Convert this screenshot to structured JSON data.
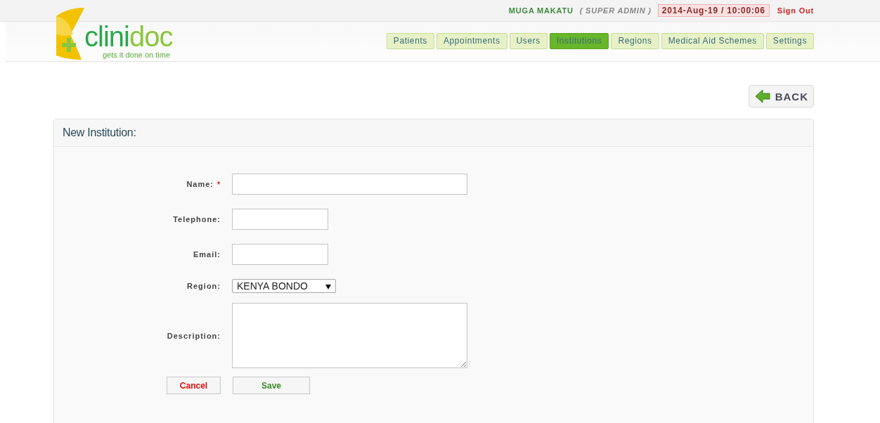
{
  "header": {
    "user": "MUGA MAKATU",
    "role": "( SUPER ADMIN )",
    "datetime": "2014-Aug-19 / 10:00:06",
    "sign_out": "Sign Out"
  },
  "logo": {
    "name": [
      "clini",
      "doc"
    ],
    "tagline": "gets it done on time"
  },
  "nav": [
    {
      "label": "Patients",
      "selected": false
    },
    {
      "label": "Appointments",
      "selected": false
    },
    {
      "label": "Users",
      "selected": false
    },
    {
      "label": "Institutions",
      "selected": true
    },
    {
      "label": "Regions",
      "selected": false
    },
    {
      "label": "Medical Aid Schemes",
      "selected": false
    },
    {
      "label": "Settings",
      "selected": false
    }
  ],
  "back_button": "BACK",
  "panel": {
    "title": "New Institution:",
    "fields": [
      {
        "label": "Name:",
        "kind": "text",
        "wide": true,
        "required": true
      },
      {
        "label": "Telephone:",
        "kind": "text",
        "wide": false,
        "required": false
      },
      {
        "label": "Email:",
        "kind": "text",
        "wide": false,
        "required": false
      },
      {
        "label": "Region:",
        "kind": "select",
        "value": "KENYA BONDO",
        "required": false
      },
      {
        "label": "Description:",
        "kind": "textarea",
        "wide": true,
        "required": false
      }
    ],
    "buttons": [
      {
        "label": "Cancel",
        "kind": "cancel"
      },
      {
        "label": "Save",
        "kind": "save"
      }
    ]
  }
}
